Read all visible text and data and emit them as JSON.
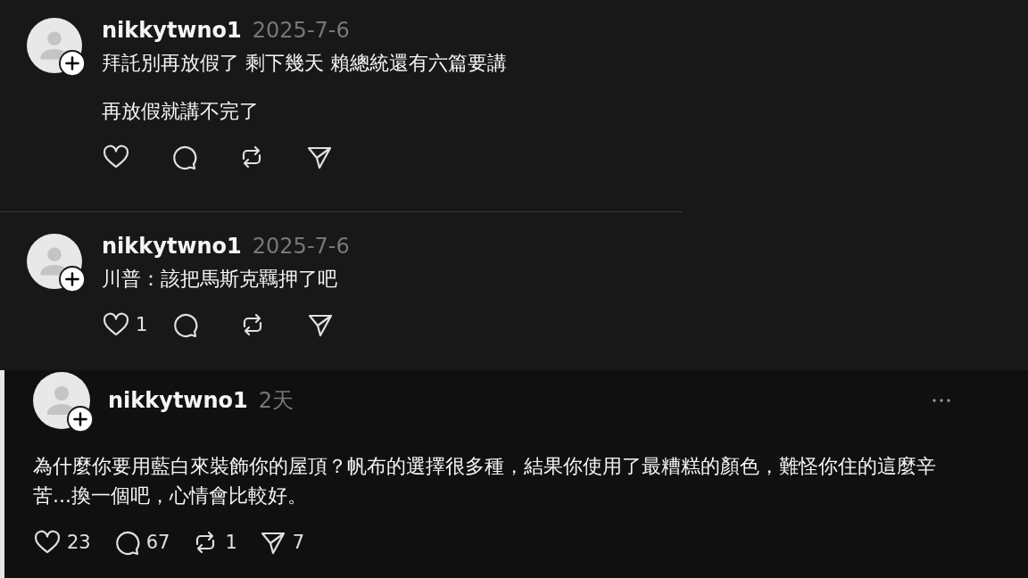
{
  "posts": [
    {
      "kind": "reply",
      "username": "nikkytwno1",
      "time": "2025-7-6",
      "paragraphs": [
        "拜託別再放假了 剩下幾天 賴總統還有六篇要講",
        "再放假就講不完了"
      ],
      "actions": [
        {
          "kind": "like"
        },
        {
          "kind": "comment"
        },
        {
          "kind": "repost"
        },
        {
          "kind": "share"
        }
      ]
    },
    {
      "kind": "reply",
      "username": "nikkytwno1",
      "time": "2025-7-6",
      "paragraphs": [
        "川普：該把馬斯克羈押了吧"
      ],
      "actions": [
        {
          "kind": "like",
          "count": "1"
        },
        {
          "kind": "comment"
        },
        {
          "kind": "repost"
        },
        {
          "kind": "share"
        }
      ]
    },
    {
      "kind": "post",
      "username": "nikkytwno1",
      "time": "2天",
      "paragraphs": [
        "為什麼你要用藍白來裝飾你的屋頂？帆布的選擇很多種，結果你使用了最糟糕的顏色，難怪你住的這麼辛苦...換一個吧，心情會比較好。"
      ],
      "actions": [
        {
          "kind": "like",
          "count": "23"
        },
        {
          "kind": "comment",
          "count": "67"
        },
        {
          "kind": "repost",
          "count": "1"
        },
        {
          "kind": "share",
          "count": "7"
        }
      ]
    }
  ]
}
